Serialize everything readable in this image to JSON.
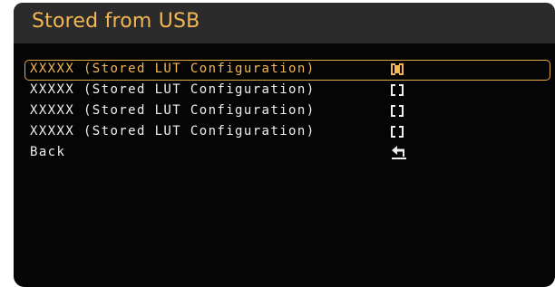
{
  "header": {
    "title": "Stored from USB"
  },
  "menu": {
    "items": [
      {
        "label": "XXXXX (Stored LUT Configuration)",
        "checked": true,
        "selected": true
      },
      {
        "label": "XXXXX (Stored LUT Configuration)",
        "checked": false,
        "selected": false
      },
      {
        "label": "XXXXX (Stored LUT Configuration)",
        "checked": false,
        "selected": false
      },
      {
        "label": "XXXXX (Stored LUT Configuration)",
        "checked": false,
        "selected": false
      }
    ],
    "back_label": "Back",
    "back_icon": "return-arrow-icon"
  },
  "colors": {
    "accent": "#f2b654",
    "text": "#f0f0f0",
    "background": "#050505",
    "title_bar": "#2b2b2b"
  }
}
